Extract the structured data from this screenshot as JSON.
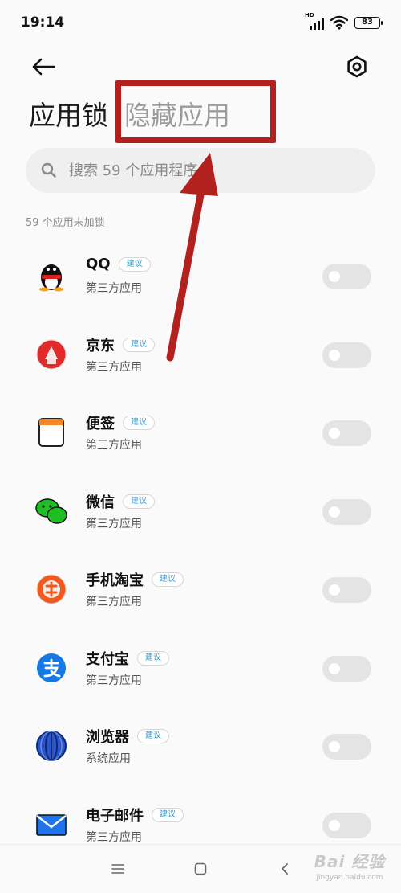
{
  "status_bar": {
    "time": "19:14",
    "network_label": "HD",
    "battery": "83"
  },
  "tabs": [
    {
      "label": "应用锁",
      "active": true
    },
    {
      "label": "隐藏应用",
      "active": false
    }
  ],
  "search": {
    "placeholder": "搜索 59 个应用程序"
  },
  "section_label": "59 个应用未加锁",
  "apps": [
    {
      "name": "QQ",
      "badge": "建议",
      "category": "第三方应用",
      "icon": "qq-icon",
      "locked": false
    },
    {
      "name": "京东",
      "badge": "建议",
      "category": "第三方应用",
      "icon": "jd-icon",
      "locked": false
    },
    {
      "name": "便签",
      "badge": "建议",
      "category": "第三方应用",
      "icon": "notes-icon",
      "locked": false
    },
    {
      "name": "微信",
      "badge": "建议",
      "category": "第三方应用",
      "icon": "wechat-icon",
      "locked": false
    },
    {
      "name": "手机淘宝",
      "badge": "建议",
      "category": "第三方应用",
      "icon": "taobao-icon",
      "locked": false
    },
    {
      "name": "支付宝",
      "badge": "建议",
      "category": "第三方应用",
      "icon": "alipay-icon",
      "locked": false
    },
    {
      "name": "浏览器",
      "badge": "建议",
      "category": "系统应用",
      "icon": "browser-icon",
      "locked": false
    },
    {
      "name": "电子邮件",
      "badge": "建议",
      "category": "第三方应用",
      "icon": "email-icon",
      "locked": false
    }
  ],
  "watermark": {
    "logo": "Bai 经验",
    "sub": "jingyan.baidu.com"
  },
  "colors": {
    "highlight": "#b3211f",
    "badge_text": "#2f9bd4",
    "toggle_off": "#e4e4e4"
  }
}
